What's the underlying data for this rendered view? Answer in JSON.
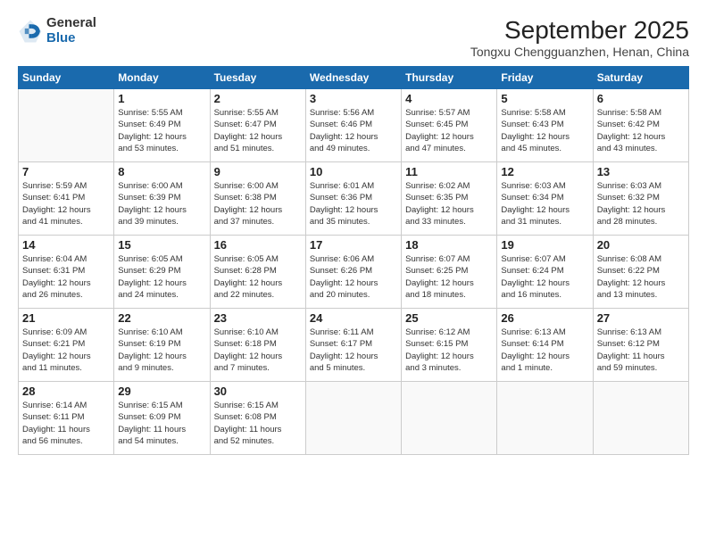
{
  "logo": {
    "general": "General",
    "blue": "Blue"
  },
  "header": {
    "month_title": "September 2025",
    "location": "Tongxu Chengguanzhen, Henan, China"
  },
  "weekdays": [
    "Sunday",
    "Monday",
    "Tuesday",
    "Wednesday",
    "Thursday",
    "Friday",
    "Saturday"
  ],
  "weeks": [
    [
      {
        "day": "",
        "info": ""
      },
      {
        "day": "1",
        "info": "Sunrise: 5:55 AM\nSunset: 6:49 PM\nDaylight: 12 hours\nand 53 minutes."
      },
      {
        "day": "2",
        "info": "Sunrise: 5:55 AM\nSunset: 6:47 PM\nDaylight: 12 hours\nand 51 minutes."
      },
      {
        "day": "3",
        "info": "Sunrise: 5:56 AM\nSunset: 6:46 PM\nDaylight: 12 hours\nand 49 minutes."
      },
      {
        "day": "4",
        "info": "Sunrise: 5:57 AM\nSunset: 6:45 PM\nDaylight: 12 hours\nand 47 minutes."
      },
      {
        "day": "5",
        "info": "Sunrise: 5:58 AM\nSunset: 6:43 PM\nDaylight: 12 hours\nand 45 minutes."
      },
      {
        "day": "6",
        "info": "Sunrise: 5:58 AM\nSunset: 6:42 PM\nDaylight: 12 hours\nand 43 minutes."
      }
    ],
    [
      {
        "day": "7",
        "info": "Sunrise: 5:59 AM\nSunset: 6:41 PM\nDaylight: 12 hours\nand 41 minutes."
      },
      {
        "day": "8",
        "info": "Sunrise: 6:00 AM\nSunset: 6:39 PM\nDaylight: 12 hours\nand 39 minutes."
      },
      {
        "day": "9",
        "info": "Sunrise: 6:00 AM\nSunset: 6:38 PM\nDaylight: 12 hours\nand 37 minutes."
      },
      {
        "day": "10",
        "info": "Sunrise: 6:01 AM\nSunset: 6:36 PM\nDaylight: 12 hours\nand 35 minutes."
      },
      {
        "day": "11",
        "info": "Sunrise: 6:02 AM\nSunset: 6:35 PM\nDaylight: 12 hours\nand 33 minutes."
      },
      {
        "day": "12",
        "info": "Sunrise: 6:03 AM\nSunset: 6:34 PM\nDaylight: 12 hours\nand 31 minutes."
      },
      {
        "day": "13",
        "info": "Sunrise: 6:03 AM\nSunset: 6:32 PM\nDaylight: 12 hours\nand 28 minutes."
      }
    ],
    [
      {
        "day": "14",
        "info": "Sunrise: 6:04 AM\nSunset: 6:31 PM\nDaylight: 12 hours\nand 26 minutes."
      },
      {
        "day": "15",
        "info": "Sunrise: 6:05 AM\nSunset: 6:29 PM\nDaylight: 12 hours\nand 24 minutes."
      },
      {
        "day": "16",
        "info": "Sunrise: 6:05 AM\nSunset: 6:28 PM\nDaylight: 12 hours\nand 22 minutes."
      },
      {
        "day": "17",
        "info": "Sunrise: 6:06 AM\nSunset: 6:26 PM\nDaylight: 12 hours\nand 20 minutes."
      },
      {
        "day": "18",
        "info": "Sunrise: 6:07 AM\nSunset: 6:25 PM\nDaylight: 12 hours\nand 18 minutes."
      },
      {
        "day": "19",
        "info": "Sunrise: 6:07 AM\nSunset: 6:24 PM\nDaylight: 12 hours\nand 16 minutes."
      },
      {
        "day": "20",
        "info": "Sunrise: 6:08 AM\nSunset: 6:22 PM\nDaylight: 12 hours\nand 13 minutes."
      }
    ],
    [
      {
        "day": "21",
        "info": "Sunrise: 6:09 AM\nSunset: 6:21 PM\nDaylight: 12 hours\nand 11 minutes."
      },
      {
        "day": "22",
        "info": "Sunrise: 6:10 AM\nSunset: 6:19 PM\nDaylight: 12 hours\nand 9 minutes."
      },
      {
        "day": "23",
        "info": "Sunrise: 6:10 AM\nSunset: 6:18 PM\nDaylight: 12 hours\nand 7 minutes."
      },
      {
        "day": "24",
        "info": "Sunrise: 6:11 AM\nSunset: 6:17 PM\nDaylight: 12 hours\nand 5 minutes."
      },
      {
        "day": "25",
        "info": "Sunrise: 6:12 AM\nSunset: 6:15 PM\nDaylight: 12 hours\nand 3 minutes."
      },
      {
        "day": "26",
        "info": "Sunrise: 6:13 AM\nSunset: 6:14 PM\nDaylight: 12 hours\nand 1 minute."
      },
      {
        "day": "27",
        "info": "Sunrise: 6:13 AM\nSunset: 6:12 PM\nDaylight: 11 hours\nand 59 minutes."
      }
    ],
    [
      {
        "day": "28",
        "info": "Sunrise: 6:14 AM\nSunset: 6:11 PM\nDaylight: 11 hours\nand 56 minutes."
      },
      {
        "day": "29",
        "info": "Sunrise: 6:15 AM\nSunset: 6:09 PM\nDaylight: 11 hours\nand 54 minutes."
      },
      {
        "day": "30",
        "info": "Sunrise: 6:15 AM\nSunset: 6:08 PM\nDaylight: 11 hours\nand 52 minutes."
      },
      {
        "day": "",
        "info": ""
      },
      {
        "day": "",
        "info": ""
      },
      {
        "day": "",
        "info": ""
      },
      {
        "day": "",
        "info": ""
      }
    ]
  ]
}
